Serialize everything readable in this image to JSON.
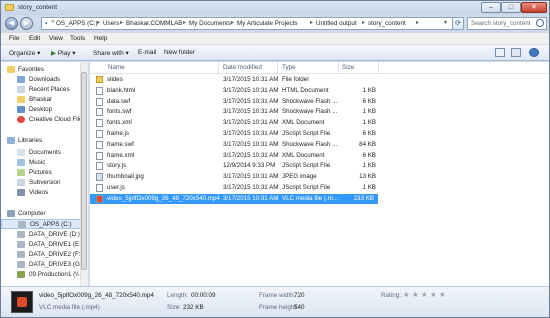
{
  "window": {
    "title": "story_content"
  },
  "address": {
    "crumbs": [
      "OS_APPS (C:)",
      "Users",
      "Bhaskar.COMMLAB",
      "My Documents",
      "My Articulate Projects",
      "Untitled output",
      "story_content"
    ],
    "search_placeholder": "Search story_content"
  },
  "menu": [
    "File",
    "Edit",
    "View",
    "Tools",
    "Help"
  ],
  "commands": {
    "organize": "Organize",
    "play": "Play",
    "share": "Share with",
    "email": "E-mail",
    "newfolder": "New folder"
  },
  "nav": {
    "favorites": {
      "header": "Favorites",
      "items": [
        "Downloads",
        "Recent Places",
        "Bhaskar",
        "Desktop",
        "Creative Cloud File"
      ]
    },
    "libraries": {
      "header": "Libraries",
      "items": [
        "Documents",
        "Music",
        "Pictures",
        "Subversion",
        "Videos"
      ]
    },
    "computer": {
      "header": "Computer",
      "items": [
        "OS_APPS (C:)",
        "DATA_DRIVE (D:)",
        "DATA_DRIVE1 (E:)",
        "DATA_DRIVE2 (F:)",
        "DATA_DRIVE3 (G:)",
        "09.Production1 (\\\\"
      ]
    }
  },
  "columns": {
    "name": "Name",
    "date": "Date modified",
    "type": "Type",
    "size": "Size"
  },
  "files": [
    {
      "name": "slides",
      "date": "3/17/2015 10:31 AM",
      "type": "File folder",
      "size": "",
      "icon": "folder"
    },
    {
      "name": "blank.html",
      "date": "3/17/2015 10:31 AM",
      "type": "HTML Document",
      "size": "1 KB",
      "icon": "html"
    },
    {
      "name": "data.swf",
      "date": "3/17/2015 10:31 AM",
      "type": "Shockwave Flash ...",
      "size": "6 KB",
      "icon": "swf"
    },
    {
      "name": "fonts.swf",
      "date": "3/17/2015 10:31 AM",
      "type": "Shockwave Flash ...",
      "size": "1 KB",
      "icon": "swf"
    },
    {
      "name": "fonts.xml",
      "date": "3/17/2015 10:31 AM",
      "type": "XML Document",
      "size": "1 KB",
      "icon": "xml"
    },
    {
      "name": "frame.js",
      "date": "3/17/2015 10:31 AM",
      "type": "JScript Script File",
      "size": "6 KB",
      "icon": "js"
    },
    {
      "name": "frame.swf",
      "date": "3/17/2015 10:31 AM",
      "type": "Shockwave Flash ...",
      "size": "84 KB",
      "icon": "swf"
    },
    {
      "name": "frame.xml",
      "date": "3/17/2015 10:31 AM",
      "type": "XML Document",
      "size": "6 KB",
      "icon": "xml"
    },
    {
      "name": "story.js",
      "date": "12/9/2014 9:33 PM",
      "type": "JScript Script File",
      "size": "1 KB",
      "icon": "js"
    },
    {
      "name": "thumbnail.jpg",
      "date": "3/17/2015 10:31 AM",
      "type": "JPEG image",
      "size": "13 KB",
      "icon": "jpg"
    },
    {
      "name": "user.js",
      "date": "3/17/2015 10:31 AM",
      "type": "JScript Script File",
      "size": "1 KB",
      "icon": "js"
    },
    {
      "name": "video_5jplfOx009g_26_48_720x540.mp4",
      "date": "3/17/2015 10:31 AM",
      "type": "VLC media file (.m...",
      "size": "233 KB",
      "icon": "mp4"
    }
  ],
  "details": {
    "filename": "video_5jplfOx009g_26_48_720x540.mp4",
    "filetype": "VLC media file (.mp4)",
    "length_label": "Length:",
    "length": "00:00:09",
    "size_label": "Size:",
    "size": "232 KB",
    "fw_label": "Frame width:",
    "fw": "720",
    "fh_label": "Frame height:",
    "fh": "540",
    "rating_label": "Rating:"
  },
  "colors": {
    "selection": "#3399ff",
    "folder": "#f3cf63"
  }
}
